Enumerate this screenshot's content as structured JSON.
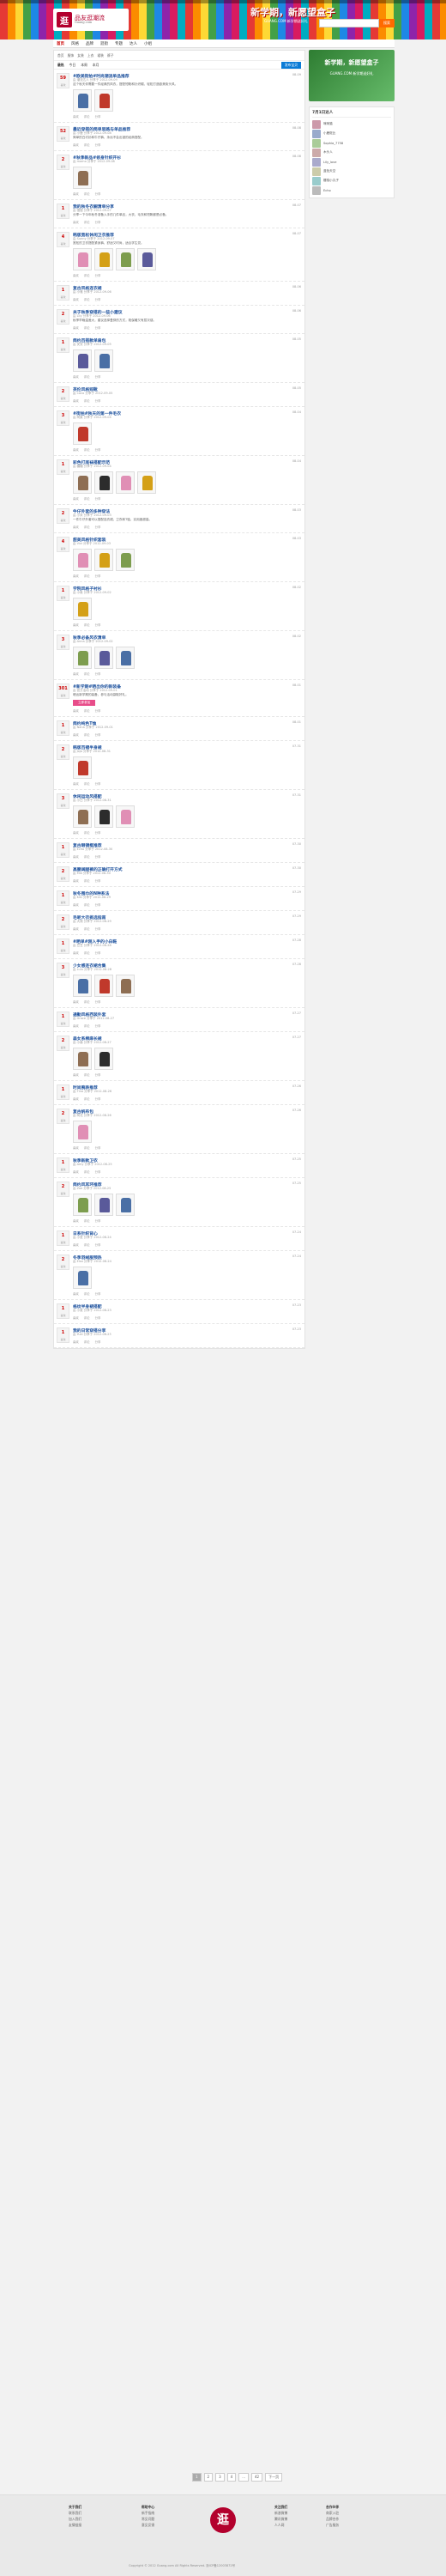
{
  "header": {
    "logo_mark": "逛",
    "logo_text": "品友逛潮流",
    "logo_sub": "Guang.com",
    "slogan": "新学期，新愿望盒子",
    "slogan_sub": "GUANG.COM 新学期送好礼",
    "search_btn": "搜索"
  },
  "nav": [
    "首页",
    "风格",
    "品牌",
    "逛街",
    "专题",
    "达人",
    "小组"
  ],
  "crumb": [
    "首页",
    "服饰",
    "女装",
    "上衣",
    "裙装",
    "裤子"
  ],
  "hot": {
    "label": "最热",
    "items": [
      "今日",
      "本周",
      "本月"
    ],
    "btn": "发布宝贝"
  },
  "posts": [
    {
      "v": "59",
      "t": "#欧美街拍#时尚潮流单品推荐",
      "m": "由 潮流达人 分享于 2012-09-09",
      "d": "这个秋天你需要一件经典的风衣，搭配短靴和针织帽，轻松打造欧美街头风。",
      "r": "08-09",
      "th": 2
    },
    {
      "v": "52",
      "t": "最近穿搭的简单思路与单品推荐",
      "m": "由 小鹿 分享于 2012-09-08",
      "d": "简单的白衬衫和牛仔裤，永远不会出错的经典搭配。",
      "r": "08-08",
      "th": 0
    },
    {
      "v": "2",
      "t": "#秋季新品#修身针织开衫",
      "m": "由 momo 分享于 2012-09-08",
      "d": "",
      "r": "08-08",
      "th": 1
    },
    {
      "v": "1",
      "t": "我的秋冬衣橱清单分享",
      "m": "由 慢慢 分享于 2012-09-07",
      "d": "分享一下今年秋冬准备入手的几件单品，大衣、毛衣和短靴都是必备。",
      "r": "08-07",
      "th": 0
    },
    {
      "v": "4",
      "t": "韩版宽松休闲卫衣推荐",
      "m": "由 Sunny 分享于 2012-09-07",
      "d": "宽松的卫衣搭配紧身裤，舒适又时尚，适合学生党。",
      "r": "08-07",
      "th": 4
    },
    {
      "v": "1",
      "t": "复古风格连衣裙",
      "m": "由 小雅 分享于 2012-09-06",
      "d": "",
      "r": "08-06",
      "th": 0
    },
    {
      "v": "2",
      "t": "关于秋季穿搭的一些小建议",
      "m": "由 Lily 分享于 2012-09-06",
      "d": "秋季早晚温差大，建议选择叠穿的方式，既保暖又有层次感。",
      "r": "08-06",
      "th": 0
    },
    {
      "v": "1",
      "t": "简约百搭款单肩包",
      "m": "由 安安 分享于 2012-09-05",
      "d": "",
      "r": "08-05",
      "th": 2
    },
    {
      "v": "2",
      "t": "英伦风格短靴",
      "m": "由 Coco 分享于 2012-09-05",
      "d": "",
      "r": "08-05",
      "th": 0
    },
    {
      "v": "3",
      "t": "#街拍#秋天的第一件毛衣",
      "m": "由 阿紫 分享于 2012-09-04",
      "d": "",
      "r": "08-04",
      "th": 1
    },
    {
      "v": "1",
      "t": "彩色打底袜搭配示范",
      "m": "由 糖糖 分享于 2012-09-04",
      "d": "",
      "r": "08-04",
      "th": 4
    },
    {
      "v": "2",
      "t": "牛仔外套的多种穿法",
      "m": "由 小米 分享于 2012-09-03",
      "d": "一件牛仔外套可以搭配连衣裙、卫衣和T恤，实用度超高。",
      "r": "08-03",
      "th": 0
    },
    {
      "v": "4",
      "t": "甜美风格针织套装",
      "m": "由 Vivi 分享于 2012-09-03",
      "d": "",
      "r": "08-03",
      "th": 3
    },
    {
      "v": "1",
      "t": "学院风格子衬衫",
      "m": "由 小鱼 分享于 2012-09-02",
      "d": "",
      "r": "08-02",
      "th": 1
    },
    {
      "v": "3",
      "t": "秋季必备风衣清单",
      "m": "由 Anna 分享于 2012-09-02",
      "d": "",
      "r": "08-02",
      "th": 3
    },
    {
      "v": "301",
      "t": "#新学期#晒出你的新装备",
      "m": "由 官方活动 分享于 2012-09-01",
      "d": "晒出新学期的装备，参与活动赢取好礼。",
      "r": "08-01",
      "th": 0,
      "btn": "立即参加"
    },
    {
      "v": "1",
      "t": "简约纯色T恤",
      "m": "由 Nana 分享于 2012-09-01",
      "d": "",
      "r": "08-01",
      "th": 0
    },
    {
      "v": "2",
      "t": "韩版百褶半身裙",
      "m": "由 Jojo 分享于 2012-08-31",
      "d": "",
      "r": "07-31",
      "th": 1
    },
    {
      "v": "3",
      "t": "休闲运动风搭配",
      "m": "由 小白 分享于 2012-08-31",
      "d": "",
      "r": "07-31",
      "th": 3
    },
    {
      "v": "1",
      "t": "复古眼镜框推荐",
      "m": "由 Echo 分享于 2012-08-30",
      "d": "",
      "r": "07-30",
      "th": 0
    },
    {
      "v": "2",
      "t": "高腰阔腿裤的正确打开方式",
      "m": "由 Mia 分享于 2012-08-30",
      "d": "",
      "r": "07-30",
      "th": 0
    },
    {
      "v": "1",
      "t": "秋冬围巾的N种系法",
      "m": "由 Kiki 分享于 2012-08-29",
      "d": "",
      "r": "07-29",
      "th": 0
    },
    {
      "v": "2",
      "t": "毛呢大衣挑选指南",
      "m": "由 大熊 分享于 2012-08-29",
      "d": "",
      "r": "07-29",
      "th": 0
    },
    {
      "v": "1",
      "t": "#晒单#刚入手的小白鞋",
      "m": "由 豆豆 分享于 2012-08-28",
      "d": "",
      "r": "07-28",
      "th": 0
    },
    {
      "v": "3",
      "t": "少女感连衣裙合集",
      "m": "由 Lulu 分享于 2012-08-28",
      "d": "",
      "r": "07-28",
      "th": 3
    },
    {
      "v": "1",
      "t": "通勤风格西装外套",
      "m": "由 Grace 分享于 2012-08-27",
      "d": "",
      "r": "07-27",
      "th": 0
    },
    {
      "v": "2",
      "t": "森女系棉麻长裙",
      "m": "由 小森 分享于 2012-08-27",
      "d": "",
      "r": "07-27",
      "th": 2
    },
    {
      "v": "1",
      "t": "时尚腕表推荐",
      "m": "由 Tina 分享于 2012-08-26",
      "d": "",
      "r": "07-26",
      "th": 0
    },
    {
      "v": "2",
      "t": "复古帆布包",
      "m": "由 阿花 分享于 2012-08-26",
      "d": "",
      "r": "07-26",
      "th": 1
    },
    {
      "v": "1",
      "t": "秋季新款卫衣",
      "m": "由 Amy 分享于 2012-08-25",
      "d": "",
      "r": "07-25",
      "th": 0
    },
    {
      "v": "2",
      "t": "简约风耳环推荐",
      "m": "由 Zoe 分享于 2012-08-25",
      "d": "",
      "r": "07-25",
      "th": 3
    },
    {
      "v": "1",
      "t": "日系针织背心",
      "m": "由 小夏 分享于 2012-08-24",
      "d": "",
      "r": "07-24",
      "th": 0
    },
    {
      "v": "2",
      "t": "冬季羽绒服预热",
      "m": "由 Elsa 分享于 2012-08-24",
      "d": "",
      "r": "07-24",
      "th": 1
    },
    {
      "v": "1",
      "t": "格纹半身裙搭配",
      "m": "由 小麦 分享于 2012-08-23",
      "d": "",
      "r": "07-23",
      "th": 0
    },
    {
      "v": "1",
      "t": "我的日常穿搭分享",
      "m": "由 Yuki 分享于 2012-08-23",
      "d": "",
      "r": "07-23",
      "th": 0
    }
  ],
  "post_actions": [
    "喜欢",
    "评论",
    "分享"
  ],
  "side": {
    "ad": "新学期，新愿望盒子",
    "ad_sub": "GUANG.COM 新学期送好礼",
    "title": "7月1日达人",
    "users": [
      "咪咪猫",
      "小鹿斑比",
      "Sophia_7758",
      "木头人",
      "Lily_love",
      "蓝色天空",
      "樱桃小丸子",
      "Echo"
    ]
  },
  "pager": [
    "1",
    "2",
    "3",
    "4",
    "...",
    "42",
    "下一页"
  ],
  "footer": {
    "c1": [
      "关于我们",
      "联系我们",
      "加入我们",
      "友情链接"
    ],
    "c2": [
      "帮助中心",
      "新手指南",
      "常见问题",
      "意见反馈"
    ],
    "c3": [
      "关注我们",
      "新浪微博",
      "腾讯微博",
      "人人网"
    ],
    "c4": [
      "合作伙伴",
      "商家入驻",
      "品牌合作",
      "广告服务"
    ],
    "copy": "Copyright © 2012 Guang.com All Rights Reserved. 浙ICP备12003872号",
    "logo": "逛"
  }
}
